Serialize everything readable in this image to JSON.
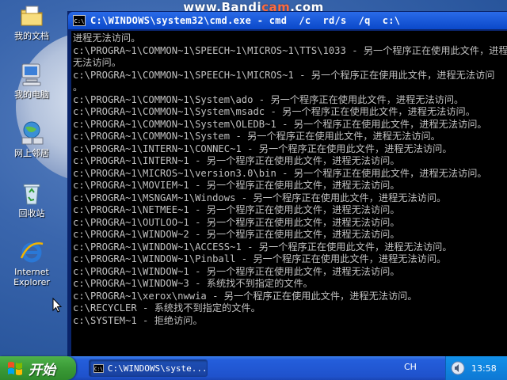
{
  "watermark": {
    "prefix": "www.",
    "brand": "Bandi",
    "brand_accent": "cam",
    "suffix": ".com",
    "accent_color": "#ff6a3d"
  },
  "desktop": {
    "icons": [
      {
        "label": "我的文档",
        "icon": "my-documents-icon"
      },
      {
        "label": "我的电脑",
        "icon": "my-computer-icon"
      },
      {
        "label": "网上邻居",
        "icon": "network-places-icon"
      },
      {
        "label": "回收站",
        "icon": "recycle-bin-icon"
      },
      {
        "label": "Internet Explorer",
        "icon": "internet-explorer-icon"
      }
    ]
  },
  "window": {
    "title": "C:\\WINDOWS\\system32\\cmd.exe - cmd  /c  rd/s  /q  c:\\",
    "title_icon_text": "C:\\"
  },
  "console": {
    "lines": [
      "进程无法访问。",
      "c:\\PROGRA~1\\COMMON~1\\SPEECH~1\\MICROS~1\\TTS\\1033 - 另一个程序正在使用此文件，进程",
      "无法访问。",
      "c:\\PROGRA~1\\COMMON~1\\SPEECH~1\\MICROS~1 - 另一个程序正在使用此文件，进程无法访问",
      "。",
      "c:\\PROGRA~1\\COMMON~1\\System\\ado - 另一个程序正在使用此文件，进程无法访问。",
      "c:\\PROGRA~1\\COMMON~1\\System\\msadc - 另一个程序正在使用此文件，进程无法访问。",
      "c:\\PROGRA~1\\COMMON~1\\System\\OLEDB~1 - 另一个程序正在使用此文件，进程无法访问。",
      "c:\\PROGRA~1\\COMMON~1\\System - 另一个程序正在使用此文件，进程无法访问。",
      "c:\\PROGRA~1\\INTERN~1\\CONNEC~1 - 另一个程序正在使用此文件，进程无法访问。",
      "c:\\PROGRA~1\\INTERN~1 - 另一个程序正在使用此文件，进程无法访问。",
      "c:\\PROGRA~1\\MICROS~1\\version3.0\\bin - 另一个程序正在使用此文件，进程无法访问。",
      "c:\\PROGRA~1\\MOVIEM~1 - 另一个程序正在使用此文件，进程无法访问。",
      "c:\\PROGRA~1\\MSNGAM~1\\Windows - 另一个程序正在使用此文件，进程无法访问。",
      "c:\\PROGRA~1\\NETMEE~1 - 另一个程序正在使用此文件，进程无法访问。",
      "c:\\PROGRA~1\\OUTLOO~1 - 另一个程序正在使用此文件，进程无法访问。",
      "c:\\PROGRA~1\\WINDOW~2 - 另一个程序正在使用此文件，进程无法访问。",
      "c:\\PROGRA~1\\WINDOW~1\\ACCESS~1 - 另一个程序正在使用此文件，进程无法访问。",
      "c:\\PROGRA~1\\WINDOW~1\\Pinball - 另一个程序正在使用此文件，进程无法访问。",
      "c:\\PROGRA~1\\WINDOW~1 - 另一个程序正在使用此文件，进程无法访问。",
      "c:\\PROGRA~1\\WINDOW~3 - 系统找不到指定的文件。",
      "c:\\PROGRA~1\\xerox\\nwwia - 另一个程序正在使用此文件，进程无法访问。",
      "c:\\RECYCLER - 系统找不到指定的文件。",
      "c:\\SYSTEM~1 - 拒绝访问。"
    ]
  },
  "taskbar": {
    "start_label": "开始",
    "task_button_label": "C:\\WINDOWS\\syste...",
    "task_button_icon_text": "C:\\",
    "language": "CH",
    "clock": "13:58"
  }
}
